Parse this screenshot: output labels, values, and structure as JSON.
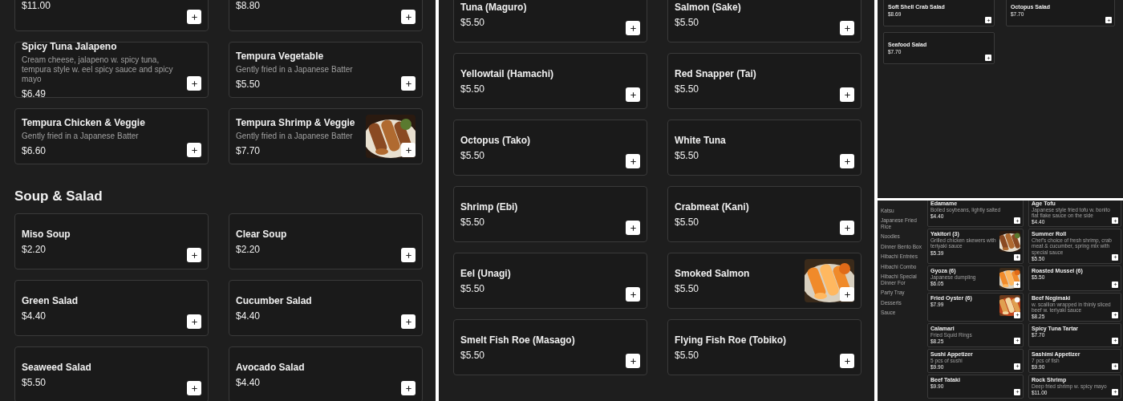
{
  "panels": [
    {
      "kind": "full",
      "sections": [
        {
          "items": [
            {
              "price": "$11.00"
            },
            {
              "price": "$8.80"
            },
            {
              "name": "Spicy Tuna Jalapeno",
              "description": "Cream cheese, jalapeno w. spicy tuna, tempura style w. eel spicy sauce and spicy mayo",
              "price": "$6.49"
            },
            {
              "name": "Tempura Vegetable",
              "description": "Gently fried in a Japanese Batter",
              "price": "$5.50"
            },
            {
              "name": "Tempura Chicken & Veggie",
              "description": "Gently fried in a Japanese Batter",
              "price": "$6.60"
            },
            {
              "name": "Tempura Shrimp & Veggie",
              "description": "Gently fried in a Japanese Batter",
              "price": "$7.70",
              "photo": true
            }
          ]
        },
        {
          "heading": "Soup & Salad",
          "items": [
            {
              "name": "Miso Soup",
              "price": "$2.20"
            },
            {
              "name": "Clear Soup",
              "price": "$2.20"
            },
            {
              "name": "Green Salad",
              "price": "$4.40"
            },
            {
              "name": "Cucumber Salad",
              "price": "$4.40"
            },
            {
              "name": "Seaweed Salad",
              "price": "$5.50"
            },
            {
              "name": "Avocado Salad",
              "price": "$4.40"
            }
          ]
        }
      ]
    },
    {
      "kind": "full",
      "sections": [
        {
          "items": [
            {
              "name": "Tuna (Maguro)",
              "price": "$5.50"
            },
            {
              "name": "Salmon (Sake)",
              "price": "$5.50"
            },
            {
              "name": "Yellowtail (Hamachi)",
              "price": "$5.50"
            },
            {
              "name": "Red Snapper (Tai)",
              "price": "$5.50"
            },
            {
              "name": "Octopus (Tako)",
              "price": "$5.50"
            },
            {
              "name": "White Tuna",
              "price": "$5.50"
            },
            {
              "name": "Shrimp (Ebi)",
              "price": "$5.50"
            },
            {
              "name": "Crabmeat (Kani)",
              "price": "$5.50"
            },
            {
              "name": "Eel (Unagi)",
              "price": "$5.50"
            },
            {
              "name": "Smoked Salmon",
              "price": "$5.50",
              "photo": true
            },
            {
              "name": "Smelt Fish Roe (Masago)",
              "price": "$5.50"
            },
            {
              "name": "Flying Fish Roe (Tobiko)",
              "price": "$5.50"
            }
          ]
        }
      ]
    },
    {
      "kind": "mini",
      "sections": [
        {
          "items": [
            {
              "name": "Soft Shell Crab Salad",
              "price": "$8.69"
            },
            {
              "name": "Octopus Salad",
              "price": "$7.70"
            },
            {
              "name": "Seafood Salad",
              "price": "$7.70"
            }
          ]
        }
      ]
    },
    {
      "kind": "sidebar",
      "sidebar": {
        "items": [
          "Katsu",
          "Japanese Fried Rice",
          "Noodles",
          "Dinner Bento Box",
          "Hibachi Entrées",
          "Hibachi Combo",
          "Hibachi Special Dinner For",
          "Party Tray",
          "Desserts",
          "Sauce"
        ]
      },
      "sections": [
        {
          "items": [
            {
              "name": "Edamame",
              "description": "Boiled soybeans, lightly salted",
              "price": "$4.40"
            },
            {
              "name": "Age Tofu",
              "description": "Japanese style fried tofu w. bonito flat flake sauce on the side",
              "price": "$4.40"
            },
            {
              "name": "Yakitori (3)",
              "description": "Grilled chicken skewers with teriyaki sauce",
              "price": "$5.39",
              "photo": true
            },
            {
              "name": "Summer Roll",
              "description": "Chef's choice of fresh shrimp, crab meat & cucumber, spring mix with special sauce",
              "price": "$5.50"
            },
            {
              "name": "Gyoza (6)",
              "description": "Japanese dumpling",
              "price": "$6.05",
              "photo": true
            },
            {
              "name": "Roasted Mussel (6)",
              "price": "$5.50"
            },
            {
              "name": "Fried Oyster (6)",
              "price": "$7.99",
              "photo": true
            },
            {
              "name": "Beef Negimaki",
              "description": "w. scallion wrapped in thinly sliced beef w. teriyaki sauce",
              "price": "$8.25"
            },
            {
              "name": "Calamari",
              "description": "Fried Squid Rings",
              "price": "$8.25"
            },
            {
              "name": "Spicy Tuna Tartar",
              "price": "$7.70"
            },
            {
              "name": "Sushi Appetizer",
              "description": "5 pcs of sushi",
              "price": "$9.90"
            },
            {
              "name": "Sashimi Appetizer",
              "description": "7 pcs of fish",
              "price": "$9.90"
            },
            {
              "name": "Beef Tataki",
              "price": "$9.90"
            },
            {
              "name": "Rock Shrimp",
              "description": "Deep fried shrimp w. spicy mayo",
              "price": "$11.00"
            }
          ]
        }
      ]
    }
  ]
}
